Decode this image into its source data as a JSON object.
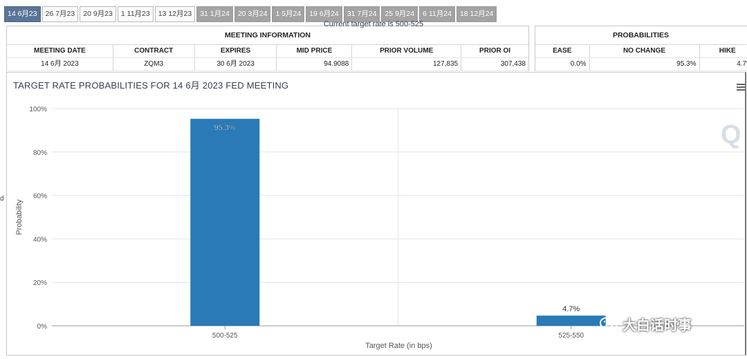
{
  "tabs": [
    {
      "label": "14 6月23",
      "state": "active"
    },
    {
      "label": "26 7月23",
      "state": "light"
    },
    {
      "label": "20 9月23",
      "state": "light"
    },
    {
      "label": "1 11月23",
      "state": "light"
    },
    {
      "label": "13 12月23",
      "state": "light"
    },
    {
      "label": "31 1月24",
      "state": "dark"
    },
    {
      "label": "20 3月24",
      "state": "dark"
    },
    {
      "label": "1 5月24",
      "state": "dark"
    },
    {
      "label": "19 6月24",
      "state": "dark"
    },
    {
      "label": "31 7月24",
      "state": "dark"
    },
    {
      "label": "25 9月24",
      "state": "dark"
    },
    {
      "label": "6 11月24",
      "state": "dark"
    },
    {
      "label": "18 12月24",
      "state": "dark"
    }
  ],
  "meeting_info": {
    "title": "MEETING INFORMATION",
    "headers": [
      "MEETING DATE",
      "CONTRACT",
      "EXPIRES",
      "MID PRICE",
      "PRIOR VOLUME",
      "PRIOR OI"
    ],
    "values": [
      "14 6月 2023",
      "ZQM3",
      "30 6月 2023",
      "94.9088",
      "127,835",
      "307,438"
    ]
  },
  "probabilities": {
    "title": "PROBABILITIES",
    "headers": [
      "EASE",
      "NO CHANGE",
      "HIKE"
    ],
    "values": [
      "0.0%",
      "95.3%",
      "4.7%"
    ]
  },
  "chart": {
    "title": "TARGET RATE PROBABILITIES FOR 14 6月 2023 FED MEETING",
    "subtitle": "Current target rate is 500-525",
    "side_char": "d",
    "watermark_letter": "Q"
  },
  "watermark": {
    "text": "大白话时事"
  },
  "chart_data": {
    "type": "bar",
    "title": "TARGET RATE PROBABILITIES FOR 14 6月 2023 FED MEETING",
    "subtitle": "Current target rate is 500-525",
    "xlabel": "Target Rate (in bps)",
    "ylabel": "Probability",
    "categories": [
      "500-525",
      "525-550"
    ],
    "values": [
      95.3,
      4.7
    ],
    "data_labels": [
      "95.3%",
      "4.7%"
    ],
    "ylim": [
      0,
      100
    ],
    "yticks": [
      "0%",
      "20%",
      "40%",
      "60%",
      "80%",
      "100%"
    ],
    "ytick_values": [
      0,
      20,
      40,
      60,
      80,
      100
    ],
    "grid": true,
    "bar_color": "#2a7ab8"
  },
  "colors": {
    "accent": "#5a7596",
    "bar": "#2a7ab8"
  }
}
